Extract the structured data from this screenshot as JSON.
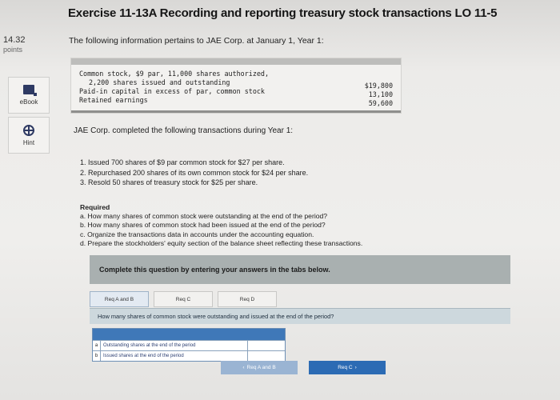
{
  "header": {
    "title": "Exercise 11-13A Recording and reporting treasury stock transactions LO 11-5"
  },
  "score": {
    "value": "14.32",
    "unit": "points"
  },
  "side_tools": [
    {
      "label": "eBook"
    },
    {
      "label": "Hint"
    }
  ],
  "intro": "The following information pertains to JAE Corp. at January 1, Year 1:",
  "balances": {
    "lines": [
      "Common stock, $9 par, 11,000 shares authorized,",
      "2,200 shares issued and outstanding",
      "Paid-in capital in excess of par, common stock",
      "Retained earnings"
    ],
    "amounts": [
      "$19,800",
      "13,100",
      "59,600"
    ]
  },
  "transactions": {
    "intro": "JAE Corp. completed the following transactions during Year 1:",
    "items": [
      "1. Issued 700 shares of $9 par common stock for $27 per share.",
      "2. Repurchased 200 shares of its own common stock for $24 per share.",
      "3. Resold 50 shares of treasury stock for $25 per share."
    ]
  },
  "required": {
    "heading": "Required",
    "items": [
      "a. How many shares of common stock were outstanding at the end of the period?",
      "b. How many shares of common stock had been issued at the end of the period?",
      "c. Organize the transactions data in accounts under the accounting equation.",
      "d. Prepare the stockholders' equity section of the balance sheet reflecting these transactions."
    ]
  },
  "instructions": "Complete this question by entering your answers in the tabs below.",
  "tabs": [
    {
      "label": "Req A and B"
    },
    {
      "label": "Req C"
    },
    {
      "label": "Req D"
    }
  ],
  "question": "How many shares of common stock were outstanding and issued at the end of the period?",
  "answer_rows": [
    {
      "letter": "a",
      "label": "Outstanding shares at the end of the period",
      "value": ""
    },
    {
      "letter": "b",
      "label": "Issued shares at the end of the period",
      "value": ""
    }
  ],
  "nav": {
    "prev_label": "Req A and B",
    "next_label": "Req C"
  }
}
